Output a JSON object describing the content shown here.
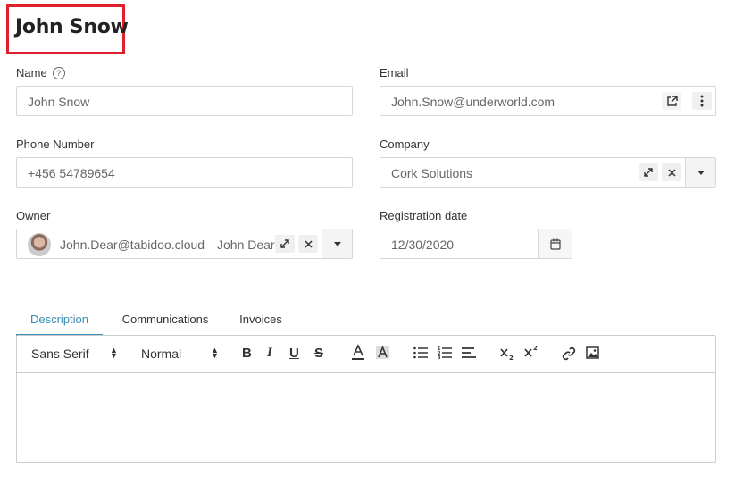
{
  "header": {
    "title": "John Snow"
  },
  "form": {
    "name": {
      "label": "Name",
      "value": "John Snow"
    },
    "email": {
      "label": "Email",
      "value": "John.Snow@underworld.com"
    },
    "phone": {
      "label": "Phone Number",
      "value": "+456 54789654"
    },
    "company": {
      "label": "Company",
      "value": "Cork Solutions"
    },
    "owner": {
      "label": "Owner",
      "email": "John.Dear@tabidoo.cloud",
      "name": "John Dear"
    },
    "registration": {
      "label": "Registration date",
      "value": "12/30/2020"
    }
  },
  "tabs": [
    {
      "label": "Description",
      "active": true
    },
    {
      "label": "Communications",
      "active": false
    },
    {
      "label": "Invoices",
      "active": false
    }
  ],
  "editor": {
    "font_family": "Sans Serif",
    "font_size": "Normal"
  },
  "colors": {
    "accent": "#3a8db5",
    "highlight_box": "#e0212d"
  }
}
